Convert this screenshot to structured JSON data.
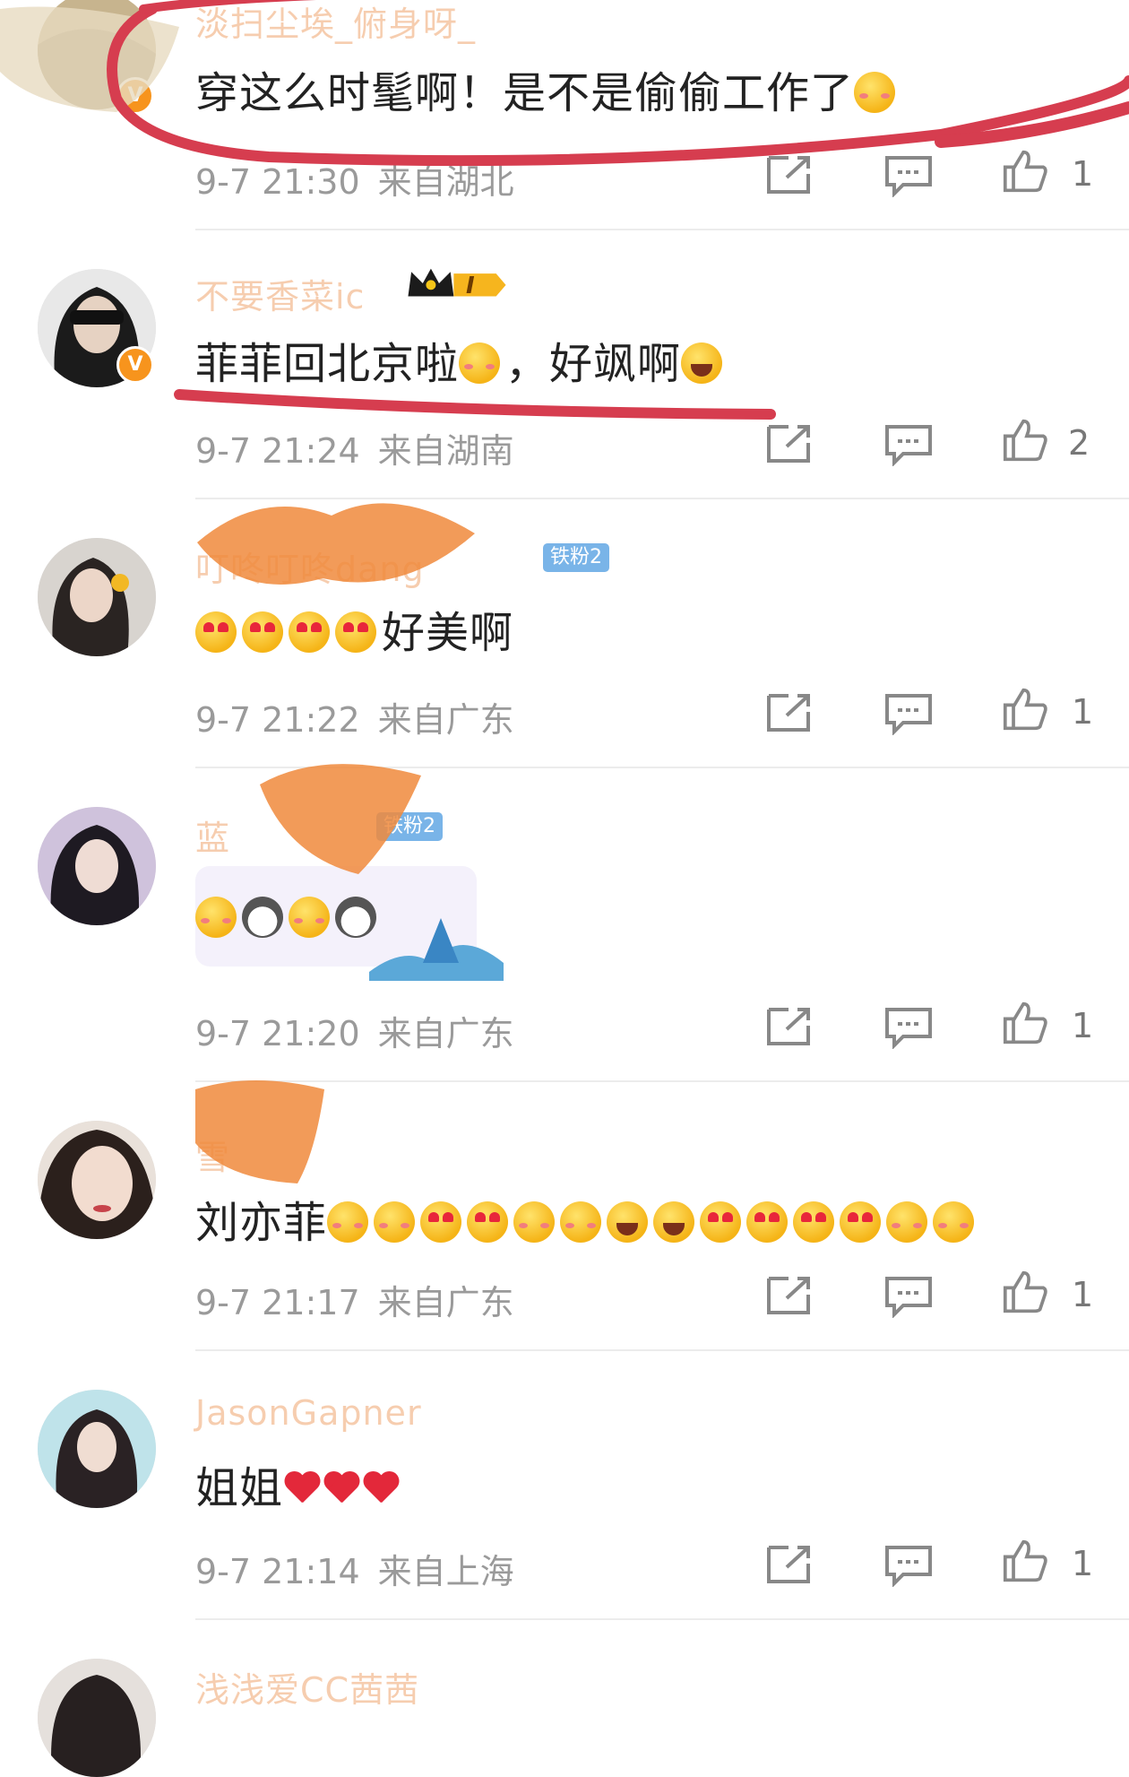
{
  "comments": [
    {
      "username": "淡扫尘埃_俯身呀_",
      "text": "穿这么时髦啊！是不是偷偷工作了",
      "emojis": [
        "shy"
      ],
      "time": "9-7 21:30",
      "location": "来自湖北",
      "likes": "1",
      "verified": true
    },
    {
      "username": "不要香菜ic",
      "text": "菲菲回北京啦",
      "text2": "，好飒啊",
      "level_badge": "I",
      "time": "9-7 21:24",
      "location": "来自湖南",
      "likes": "2",
      "verified": true
    },
    {
      "username": "叮咚叮咚dang",
      "fan_badge": "铁粉2",
      "text": "好美啊",
      "time": "9-7 21:22",
      "location": "来自广东",
      "likes": "1"
    },
    {
      "username": "蓝",
      "fan_badge": "铁粉2",
      "text": "",
      "time": "9-7 21:20",
      "location": "来自广东",
      "likes": "1"
    },
    {
      "username": "雪",
      "text": "刘亦菲",
      "time": "9-7 21:17",
      "location": "来自广东",
      "likes": "1"
    },
    {
      "username": "JasonGapner",
      "text": "姐姐",
      "time": "9-7 21:14",
      "location": "来自上海",
      "likes": "1"
    },
    {
      "username": "浅浅爱CC茜茜"
    }
  ],
  "colors": {
    "annotation_red": "#d63d4f",
    "scribble_orange": "#f08a3c",
    "meta_gray": "#9a9a9a",
    "verified_orange": "#f7941d",
    "fan_badge_blue": "#79b4e8"
  },
  "icons": {
    "repost": "repost-icon",
    "comment": "comment-icon",
    "like": "thumbs-up-icon"
  }
}
